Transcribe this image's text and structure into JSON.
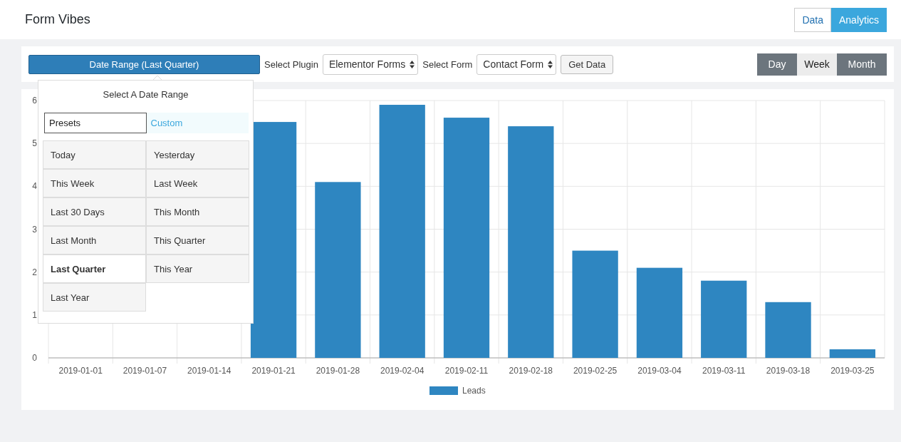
{
  "header": {
    "title": "Form Vibes",
    "view_tabs": [
      {
        "label": "Data",
        "selected": false
      },
      {
        "label": "Analytics",
        "selected": true
      }
    ]
  },
  "toolbar": {
    "date_range_button": "Date Range (Last Quarter)",
    "selects": [
      {
        "label": "Select Plugin",
        "value": "Elementor Forms"
      },
      {
        "label": "Select Form",
        "value": "Contact Form"
      }
    ],
    "get_data_button": "Get Data",
    "period_tabs": [
      {
        "label": "Day",
        "selected": false
      },
      {
        "label": "Week",
        "selected": true
      },
      {
        "label": "Month",
        "selected": false
      }
    ]
  },
  "date_popup": {
    "title": "Select A Date Range",
    "mode_tabs": [
      {
        "label": "Presets",
        "selected": true
      },
      {
        "label": "Custom",
        "selected": false
      }
    ],
    "presets": [
      {
        "label": "Today",
        "selected": false
      },
      {
        "label": "Yesterday",
        "selected": false
      },
      {
        "label": "This Week",
        "selected": false
      },
      {
        "label": "Last Week",
        "selected": false
      },
      {
        "label": "Last 30 Days",
        "selected": false
      },
      {
        "label": "This Month",
        "selected": false
      },
      {
        "label": "Last Month",
        "selected": false
      },
      {
        "label": "This Quarter",
        "selected": false
      },
      {
        "label": "Last Quarter",
        "selected": true
      },
      {
        "label": "This Year",
        "selected": false
      },
      {
        "label": "Last Year",
        "selected": false
      }
    ]
  },
  "chart": {
    "chart_data": {
      "type": "bar",
      "categories": [
        "2019-01-01",
        "2019-01-07",
        "2019-01-14",
        "2019-01-21",
        "2019-01-28",
        "2019-02-04",
        "2019-02-11",
        "2019-02-18",
        "2019-02-25",
        "2019-03-04",
        "2019-03-11",
        "2019-03-18",
        "2019-03-25"
      ],
      "series": [
        {
          "name": "Leads",
          "color": "#2e86c1",
          "values": [
            null,
            null,
            null,
            5.5,
            4.1,
            5.9,
            5.6,
            5.4,
            2.5,
            2.1,
            1.8,
            1.3,
            0.2
          ]
        }
      ],
      "ylim": [
        0,
        6
      ],
      "grid": true,
      "yticks": [
        0,
        1,
        2,
        3,
        4,
        5,
        6
      ]
    }
  }
}
